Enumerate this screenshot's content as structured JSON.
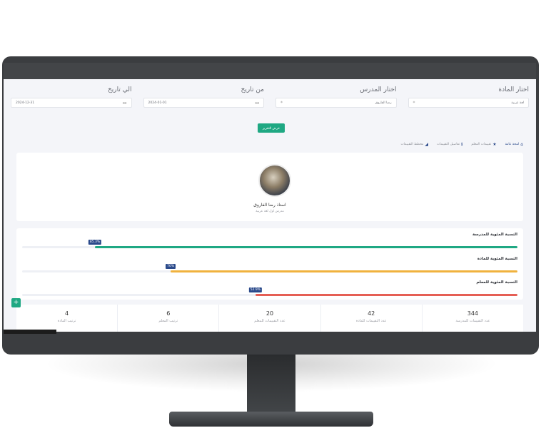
{
  "filters": {
    "subject": {
      "label": "اختار المادة",
      "value": "لغة عربية"
    },
    "teacher": {
      "label": "اختار المدرس",
      "value": "رضا الفاروق"
    },
    "from_date": {
      "label": "من تاريخ",
      "value": "2024-01-01"
    },
    "to_date": {
      "label": "الي تاريخ",
      "value": "2024-12-31"
    },
    "show_button": "عرض التقرير"
  },
  "tabs": [
    {
      "label": "لمحة عامة",
      "icon": "home-icon",
      "active": true
    },
    {
      "label": "تقييمات المعلم",
      "icon": "star-icon",
      "active": false
    },
    {
      "label": "تفاصيل التقييمات",
      "icon": "info-icon",
      "active": false
    },
    {
      "label": "مخطط التقييمات",
      "icon": "chart-icon",
      "active": false
    }
  ],
  "teacher_card": {
    "name": "استاذ رضا الفاروق",
    "subtitle": "مدرس اول لغة عربية"
  },
  "progress": [
    {
      "label": "النسبة المئوية للمدرسة",
      "percent": 85.3,
      "badge": "85.3%",
      "color": "#1fa883"
    },
    {
      "label": "النسبة المئوية للمادة",
      "percent": 70,
      "badge": "70%",
      "color": "#f0b23e"
    },
    {
      "label": "النسبة المئوية للمعلم",
      "percent": 52.9,
      "badge": "52.9%",
      "color": "#e55f55"
    }
  ],
  "stats": [
    {
      "value": "344",
      "label": "عدد التقييمات للمدرسة"
    },
    {
      "value": "42",
      "label": "عدد التقييمات للمادة"
    },
    {
      "value": "20",
      "label": "عدد التقييمات للمعلم"
    },
    {
      "value": "6",
      "label": "ترتيب المعلم"
    },
    {
      "value": "4",
      "label": "ترتيب المادة"
    }
  ],
  "fab_label": "+",
  "colors": {
    "accent": "#1fa883",
    "primary": "#2b4a8b"
  }
}
